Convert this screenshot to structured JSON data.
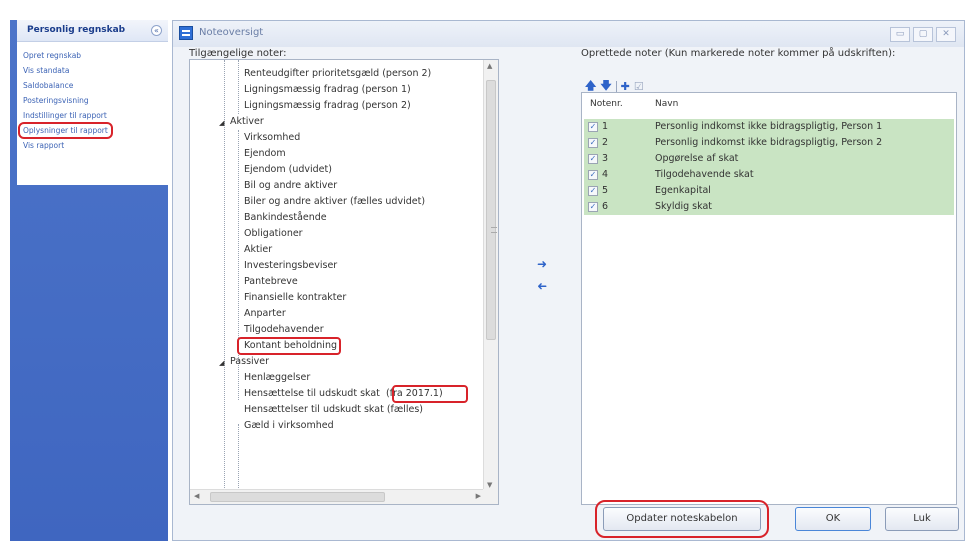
{
  "sidebar": {
    "title": "Personlig regnskab",
    "collapse_glyph": "«",
    "links": [
      "Opret regnskab",
      "Vis standata",
      "Saldobalance",
      "Posteringsvisning",
      "Indstillinger til rapport",
      "Oplysninger til rapport",
      "Vis rapport"
    ]
  },
  "dialog": {
    "title": "Noteoversigt",
    "window_buttons": [
      "▭",
      "▢",
      "✕"
    ]
  },
  "left_panel": {
    "label": "Tilgængelige noter:",
    "items": [
      "Renteudgifter prioritetsgæld (person 2)",
      "Ligningsmæssig fradrag (person 1)",
      "Ligningsmæssig fradrag (person 2)",
      "Aktiver",
      "Virksomhed",
      "Ejendom",
      "Ejendom (udvidet)",
      "Bil og andre aktiver",
      "Biler og andre aktiver (fælles udvidet)",
      "Bankindestående",
      "Obligationer",
      "Aktier",
      "Investeringsbeviser",
      "Pantebreve",
      "Finansielle kontrakter",
      "Anparter",
      "Tilgodehavender",
      "Kontant beholdning",
      "Passiver",
      "Henlæggelser",
      "Hensættelse til udskudt skat",
      "Hensættelser til udskudt skat (fælles)",
      "Gæld i virksomhed"
    ],
    "highlight_tag": "(fra 2017.1)"
  },
  "right_panel": {
    "label": "Oprettede noter (Kun markerede noter kommer på udskriften):",
    "col_num": "Notenr.",
    "col_name": "Navn",
    "rows": [
      {
        "num": "1",
        "name": "Personlig indkomst ikke bidragspligtig, Person 1"
      },
      {
        "num": "2",
        "name": "Personlig indkomst ikke bidragspligtig, Person 2"
      },
      {
        "num": "3",
        "name": "Opgørelse af skat"
      },
      {
        "num": "4",
        "name": "Tilgodehavende skat"
      },
      {
        "num": "5",
        "name": "Egenkapital"
      },
      {
        "num": "6",
        "name": "Skyldig skat"
      }
    ]
  },
  "buttons": {
    "update": "Opdater noteskabelon",
    "ok": "OK",
    "close": "Luk"
  },
  "colors": {
    "accent": "#2e63c9",
    "highlight_red": "#d8232a",
    "row_green": "#c9e4c3",
    "sidebar_blue": "#4c74c9"
  }
}
